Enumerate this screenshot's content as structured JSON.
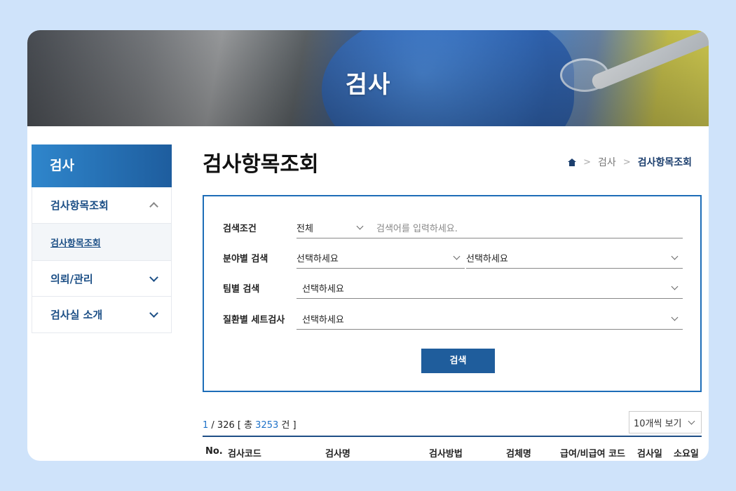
{
  "banner": {
    "title": "검사"
  },
  "sidebar": {
    "header": "검사",
    "items": [
      {
        "label": "검사항목조회",
        "expanded": true,
        "sub": [
          "검사항목조회"
        ]
      },
      {
        "label": "의뢰/관리",
        "expanded": false
      },
      {
        "label": "검사실 소개",
        "expanded": false
      }
    ]
  },
  "page": {
    "title": "검사항목조회",
    "breadcrumb": [
      "home-icon",
      "검사",
      "검사항목조회"
    ]
  },
  "search": {
    "condition_label": "검색조건",
    "condition_value": "전체",
    "keyword_placeholder": "검색어를 입력하세요.",
    "field_label": "분야별 검색",
    "field_select1": "선택하세요",
    "field_select2": "선택하세요",
    "team_label": "팀별 검색",
    "team_select": "선택하세요",
    "disease_label": "질환별 세트검사",
    "disease_select": "선택하세요",
    "button": "검색"
  },
  "results": {
    "page_current": "1",
    "page_total_text": " / 326 [ 총 ",
    "total_count": "3253",
    "count_suffix": " 건 ]",
    "per_page": "10개씩 보기"
  },
  "table": {
    "headers": [
      "No.",
      "검사코드",
      "검사명",
      "검사방법",
      "검체명",
      "급여/비급여 코드",
      "검사일",
      "소요일"
    ]
  },
  "colors": {
    "accent": "#1d6db8",
    "sidebar_text": "#1c4f86",
    "button": "#1f5d9c",
    "background": "#cfe3fa"
  }
}
